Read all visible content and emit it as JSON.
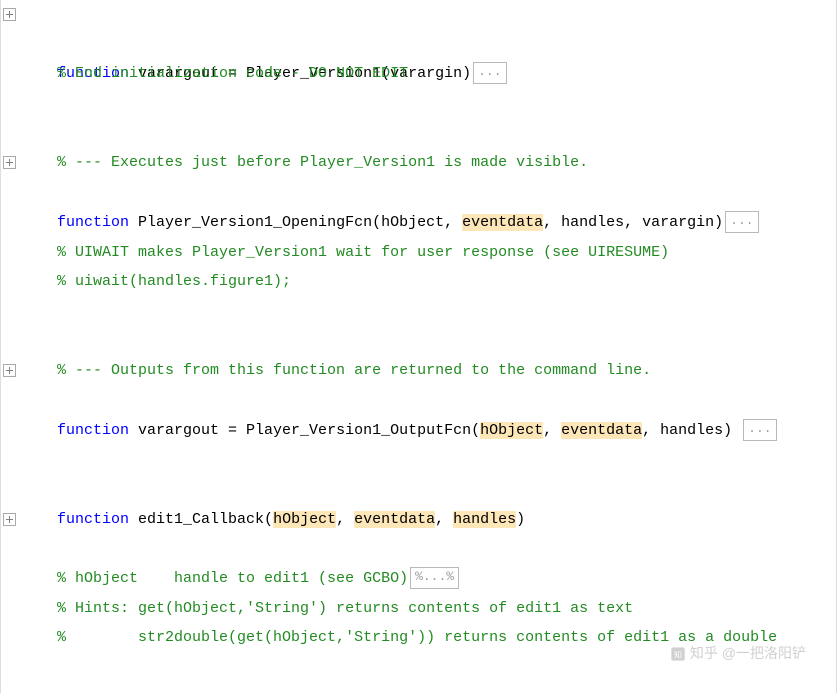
{
  "lines": {
    "l1_kw": "function",
    "l1_rest": " varargout = Player_Version1(varargin)",
    "l1_ell": "...",
    "l2": "% End initialization code - DO NOT EDIT",
    "l5": "% --- Executes just before Player_Version1 is made visible.",
    "l6_kw": "function",
    "l6_a": " Player_Version1_OpeningFcn(hObject, ",
    "l6_h1": "eventdata",
    "l6_b": ", handles, varargin)",
    "l6_ell": "...",
    "l8": "% UIWAIT makes Player_Version1 wait for user response (see UIRESUME)",
    "l9": "% uiwait(handles.figure1);",
    "l12": "% --- Outputs from this function are returned to the command line.",
    "l13_kw": "function",
    "l13_a": " varargout = Player_Version1_OutputFcn(",
    "l13_h1": "hObject",
    "l13_b": ", ",
    "l13_h2": "eventdata",
    "l13_c": ", handles) ",
    "l13_ell": "...",
    "l17_kw": "function",
    "l17_a": " edit1_Callback(",
    "l17_h1": "hObject",
    "l17_b": ", ",
    "l17_h2": "eventdata",
    "l17_c": ", ",
    "l17_h3": "handles",
    "l17_d": ")",
    "l18_a": "% hObject    handle to edit1 (see GCBO)",
    "l18_ell": "%...%",
    "l20": "% Hints: get(hObject,'String') returns contents of edit1 as text",
    "l21": "%        str2double(get(hObject,'String')) returns contents of edit1 as a double"
  },
  "watermark": "知乎 @一把洛阳铲"
}
